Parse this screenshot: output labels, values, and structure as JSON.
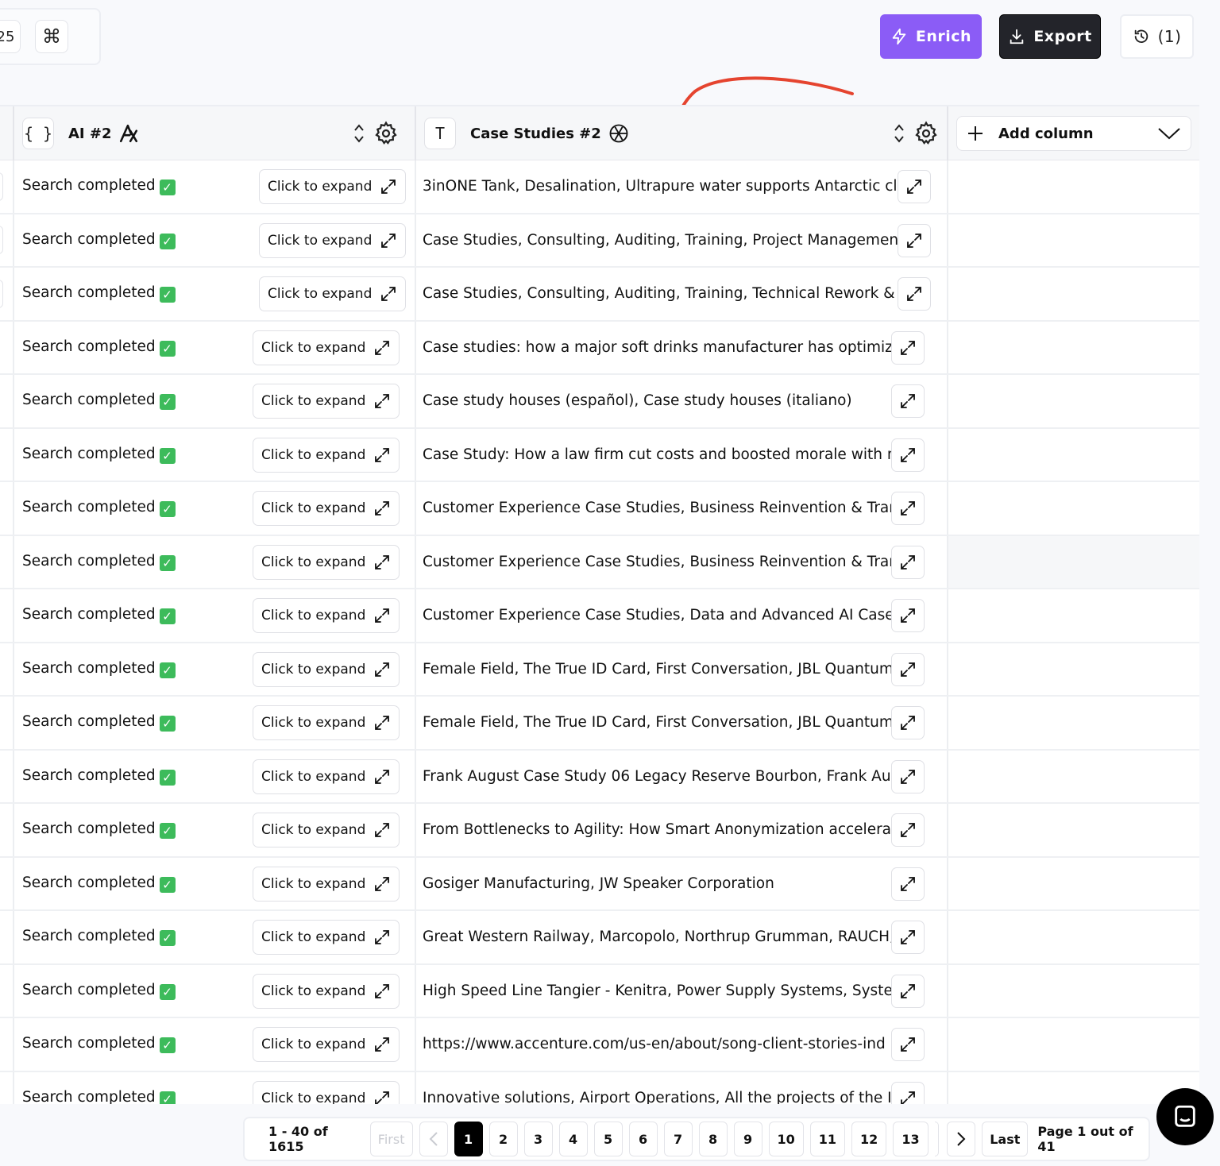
{
  "toolbar": {
    "shortcut_number": "25",
    "shortcut_cmd_glyph": "⌘",
    "enrich_label": "Enrich",
    "export_label": "Export",
    "history_label": "(1)"
  },
  "table": {
    "columns": [
      {
        "type_glyph": "{ }",
        "title": "AI #2",
        "icon": "ai-model-icon"
      },
      {
        "type_glyph": "T",
        "title": "Case Studies #2",
        "icon": "openai-icon"
      }
    ],
    "add_column_label": "Add column",
    "expand_label": "Click to expand",
    "status_text": "Search completed",
    "rows": [
      "3inONE Tank, Desalination, Ultrapure water supports Antarctic clim",
      "Case Studies, Consulting, Auditing, Training, Project Management (",
      "Case Studies, Consulting, Auditing, Training, Technical Rework & Re",
      "Case studies: how a major soft drinks manufacturer has optimized",
      "Case study houses (español), Case study houses (italiano)",
      "Case Study: How a law firm cut costs and boosted morale with ma",
      "Customer Experience Case Studies, Business Reinvention & Transfo",
      "Customer Experience Case Studies, Business Reinvention & Transfo",
      "Customer Experience Case Studies, Data and Advanced AI Case St",
      "Female Field, The True ID Card, First Conversation, JBL Quantum Gu",
      "Female Field, The True ID Card, First Conversation, JBL Quantum Gu",
      "Frank August Case Study 06 Legacy Reserve Bourbon, Frank August",
      "From Bottlenecks to Agility: How Smart Anonymization accelerates",
      "Gosiger Manufacturing, JW Speaker Corporation",
      "Great Western Railway, Marcopolo, Northrup Grumman, RAUCH, J.\\",
      "High Speed Line Tangier - Kenitra, Power Supply Systems, System I",
      "https://www.accenture.com/us-en/about/song-client-stories-ind",
      "Innovative solutions, Airport Operations, All the projects of the Inno"
    ]
  },
  "pagination": {
    "range_label": "1 - 40 of 1615",
    "first_label": "First",
    "last_label": "Last",
    "pages": [
      "1",
      "2",
      "3",
      "4",
      "5",
      "6",
      "7",
      "8",
      "9",
      "10",
      "11",
      "12",
      "13"
    ],
    "current_page": "1",
    "page_info": "Page 1 out of 41"
  },
  "colors": {
    "enrich": "#8b5cf6",
    "export": "#23242a",
    "annotation_arrow": "#e5442f",
    "check": "#3dbb5b"
  }
}
